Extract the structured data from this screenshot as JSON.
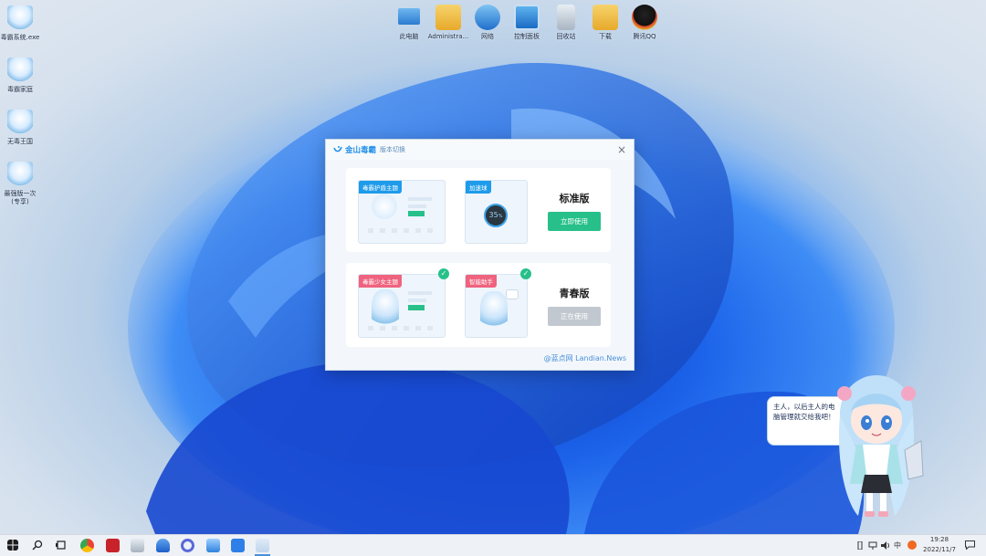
{
  "desktop_icons_left": [
    {
      "label": "毒霸系统.exe",
      "icon": "anime-girl-icon"
    },
    {
      "label": "毒霸家庭",
      "icon": "anime-girl-icon"
    },
    {
      "label": "无毒王国",
      "icon": "anime-girl-icon"
    },
    {
      "label": "最强版一次\n(专享)",
      "icon": "anime-girl-icon"
    }
  ],
  "desktop_icons_top": [
    {
      "label": "此电脑",
      "icon": "computer-icon"
    },
    {
      "label": "Administra...",
      "icon": "user-folder-icon"
    },
    {
      "label": "网络",
      "icon": "network-icon"
    },
    {
      "label": "控制面板",
      "icon": "control-panel-icon"
    },
    {
      "label": "回收站",
      "icon": "recycle-bin-icon"
    },
    {
      "label": "下载",
      "icon": "download-folder-icon"
    },
    {
      "label": "腾讯QQ",
      "icon": "qq-penguin-icon"
    }
  ],
  "dialog": {
    "brand": "金山毒霸",
    "subtitle": "版本切换",
    "close": "×",
    "standard": {
      "title": "标准版",
      "button": "立即使用",
      "theme_tag": "毒霸护盾主题",
      "speed_tag": "加速球",
      "speed_value": "35",
      "speed_unit": "%"
    },
    "youth": {
      "title": "青春版",
      "button": "正在使用",
      "theme_tag": "毒霸少女主题",
      "assistant_tag": "智能助手"
    },
    "watermark": "@蓝点网 Landian.News"
  },
  "mascot": {
    "speech": "主人，以后主人的电脑管理就交给我吧！"
  },
  "taskbar": {
    "apps": [
      "windows-start-icon",
      "search-icon",
      "task-view-icon",
      "chrome-icon",
      "filezilla-icon",
      "remote-desktop-icon",
      "onedrive-icon",
      "circle-app-icon",
      "cloud-app-icon",
      "kuaihe-icon",
      "duba-icon"
    ],
    "time": "19:28",
    "date": "2022/11/7"
  },
  "colors": {
    "brand_blue": "#1f8ee8",
    "tag_blue": "#1e9bea",
    "tag_pink": "#f0637f",
    "primary_green": "#27c08a",
    "disabled_gray": "#c2c8d0"
  }
}
